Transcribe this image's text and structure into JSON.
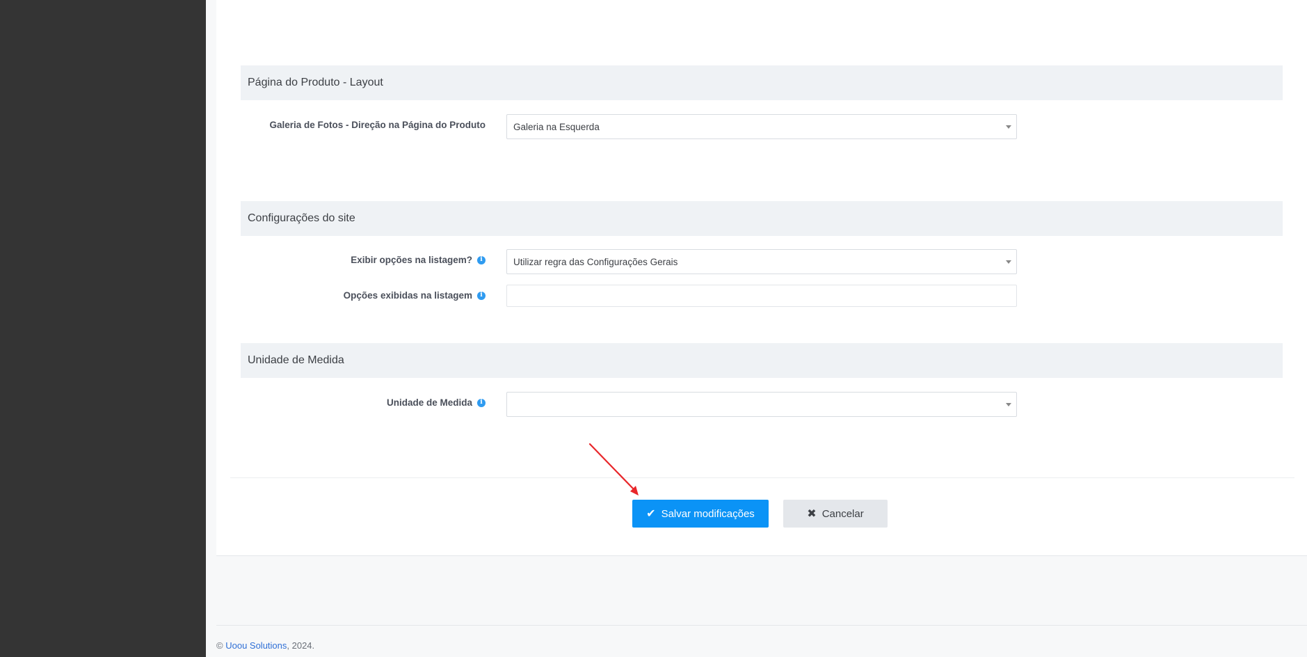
{
  "sections": {
    "product_layout": {
      "title": "Página do Produto - Layout",
      "gallery_label": "Galeria de Fotos - Direção na Página do Produto",
      "gallery_value": "Galeria na Esquerda"
    },
    "site_config": {
      "title": "Configurações do site",
      "show_options_label": "Exibir opções na listagem?",
      "show_options_value": "Utilizar regra das Configurações Gerais",
      "shown_options_label": "Opções exibidas na listagem",
      "shown_options_value": ""
    },
    "unit": {
      "title": "Unidade de Medida",
      "unit_label": "Unidade de Medida",
      "unit_value": ""
    }
  },
  "actions": {
    "save_label": "Salvar modificações",
    "cancel_label": "Cancelar",
    "save_icon": "check-icon",
    "cancel_icon": "times-icon"
  },
  "footer": {
    "copyright_symbol": "©",
    "company": "Uoou Solutions",
    "year_suffix": ", 2024."
  },
  "colors": {
    "sidebar": "#343434",
    "primary": "#0b93f6",
    "section_header": "#eff2f5",
    "annotation_arrow": "#e8262a"
  },
  "info_icon_glyph": "i"
}
